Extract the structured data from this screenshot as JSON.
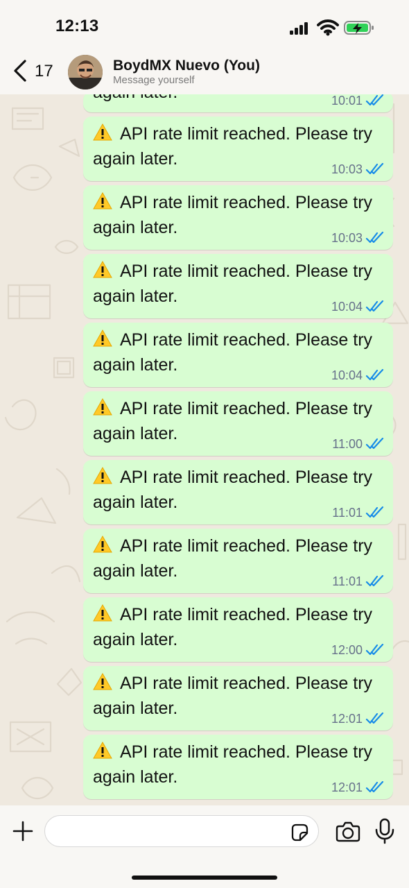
{
  "status_bar": {
    "time": "12:13"
  },
  "header": {
    "back_count": "17",
    "contact_name": "BoydMX Nuevo (You)",
    "subtitle": "Message yourself"
  },
  "messages": [
    {
      "text_line_1": "again later.",
      "text_line_2": "",
      "time": "10:01",
      "partial": true
    },
    {
      "text_line_1": "API rate limit reached. Please try",
      "text_line_2": "again later.",
      "time": "10:03"
    },
    {
      "text_line_1": "API rate limit reached. Please try",
      "text_line_2": "again later.",
      "time": "10:03"
    },
    {
      "text_line_1": "API rate limit reached. Please try",
      "text_line_2": "again later.",
      "time": "10:04"
    },
    {
      "text_line_1": "API rate limit reached. Please try",
      "text_line_2": "again later.",
      "time": "10:04"
    },
    {
      "text_line_1": "API rate limit reached. Please try",
      "text_line_2": "again later.",
      "time": "11:00"
    },
    {
      "text_line_1": "API rate limit reached. Please try",
      "text_line_2": "again later.",
      "time": "11:01"
    },
    {
      "text_line_1": "API rate limit reached. Please try",
      "text_line_2": "again later.",
      "time": "11:01"
    },
    {
      "text_line_1": "API rate limit reached. Please try",
      "text_line_2": "again later.",
      "time": "12:00"
    },
    {
      "text_line_1": "API rate limit reached. Please try",
      "text_line_2": "again later.",
      "time": "12:01"
    },
    {
      "text_line_1": "API rate limit reached. Please try",
      "text_line_2": "again later.",
      "time": "12:01"
    }
  ],
  "composer": {
    "placeholder": ""
  },
  "colors": {
    "bubble": "#d8fdd2",
    "read_ticks": "#168be8",
    "battery_fill": "#30d158"
  },
  "icons": {
    "status": [
      "signal-icon",
      "wifi-icon",
      "battery-charging-icon"
    ],
    "message": "warning-icon",
    "composer": [
      "plus-icon",
      "sticker-icon",
      "camera-icon",
      "microphone-icon"
    ]
  }
}
